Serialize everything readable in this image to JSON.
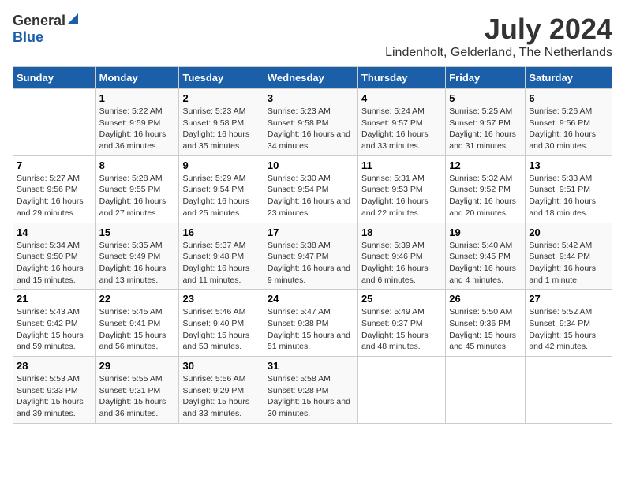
{
  "logo": {
    "general": "General",
    "blue": "Blue"
  },
  "title": {
    "month_year": "July 2024",
    "location": "Lindenholt, Gelderland, The Netherlands"
  },
  "days_of_week": [
    "Sunday",
    "Monday",
    "Tuesday",
    "Wednesday",
    "Thursday",
    "Friday",
    "Saturday"
  ],
  "weeks": [
    [
      {
        "num": "",
        "sunrise": "",
        "sunset": "",
        "daylight": ""
      },
      {
        "num": "1",
        "sunrise": "Sunrise: 5:22 AM",
        "sunset": "Sunset: 9:59 PM",
        "daylight": "Daylight: 16 hours and 36 minutes."
      },
      {
        "num": "2",
        "sunrise": "Sunrise: 5:23 AM",
        "sunset": "Sunset: 9:58 PM",
        "daylight": "Daylight: 16 hours and 35 minutes."
      },
      {
        "num": "3",
        "sunrise": "Sunrise: 5:23 AM",
        "sunset": "Sunset: 9:58 PM",
        "daylight": "Daylight: 16 hours and 34 minutes."
      },
      {
        "num": "4",
        "sunrise": "Sunrise: 5:24 AM",
        "sunset": "Sunset: 9:57 PM",
        "daylight": "Daylight: 16 hours and 33 minutes."
      },
      {
        "num": "5",
        "sunrise": "Sunrise: 5:25 AM",
        "sunset": "Sunset: 9:57 PM",
        "daylight": "Daylight: 16 hours and 31 minutes."
      },
      {
        "num": "6",
        "sunrise": "Sunrise: 5:26 AM",
        "sunset": "Sunset: 9:56 PM",
        "daylight": "Daylight: 16 hours and 30 minutes."
      }
    ],
    [
      {
        "num": "7",
        "sunrise": "Sunrise: 5:27 AM",
        "sunset": "Sunset: 9:56 PM",
        "daylight": "Daylight: 16 hours and 29 minutes."
      },
      {
        "num": "8",
        "sunrise": "Sunrise: 5:28 AM",
        "sunset": "Sunset: 9:55 PM",
        "daylight": "Daylight: 16 hours and 27 minutes."
      },
      {
        "num": "9",
        "sunrise": "Sunrise: 5:29 AM",
        "sunset": "Sunset: 9:54 PM",
        "daylight": "Daylight: 16 hours and 25 minutes."
      },
      {
        "num": "10",
        "sunrise": "Sunrise: 5:30 AM",
        "sunset": "Sunset: 9:54 PM",
        "daylight": "Daylight: 16 hours and 23 minutes."
      },
      {
        "num": "11",
        "sunrise": "Sunrise: 5:31 AM",
        "sunset": "Sunset: 9:53 PM",
        "daylight": "Daylight: 16 hours and 22 minutes."
      },
      {
        "num": "12",
        "sunrise": "Sunrise: 5:32 AM",
        "sunset": "Sunset: 9:52 PM",
        "daylight": "Daylight: 16 hours and 20 minutes."
      },
      {
        "num": "13",
        "sunrise": "Sunrise: 5:33 AM",
        "sunset": "Sunset: 9:51 PM",
        "daylight": "Daylight: 16 hours and 18 minutes."
      }
    ],
    [
      {
        "num": "14",
        "sunrise": "Sunrise: 5:34 AM",
        "sunset": "Sunset: 9:50 PM",
        "daylight": "Daylight: 16 hours and 15 minutes."
      },
      {
        "num": "15",
        "sunrise": "Sunrise: 5:35 AM",
        "sunset": "Sunset: 9:49 PM",
        "daylight": "Daylight: 16 hours and 13 minutes."
      },
      {
        "num": "16",
        "sunrise": "Sunrise: 5:37 AM",
        "sunset": "Sunset: 9:48 PM",
        "daylight": "Daylight: 16 hours and 11 minutes."
      },
      {
        "num": "17",
        "sunrise": "Sunrise: 5:38 AM",
        "sunset": "Sunset: 9:47 PM",
        "daylight": "Daylight: 16 hours and 9 minutes."
      },
      {
        "num": "18",
        "sunrise": "Sunrise: 5:39 AM",
        "sunset": "Sunset: 9:46 PM",
        "daylight": "Daylight: 16 hours and 6 minutes."
      },
      {
        "num": "19",
        "sunrise": "Sunrise: 5:40 AM",
        "sunset": "Sunset: 9:45 PM",
        "daylight": "Daylight: 16 hours and 4 minutes."
      },
      {
        "num": "20",
        "sunrise": "Sunrise: 5:42 AM",
        "sunset": "Sunset: 9:44 PM",
        "daylight": "Daylight: 16 hours and 1 minute."
      }
    ],
    [
      {
        "num": "21",
        "sunrise": "Sunrise: 5:43 AM",
        "sunset": "Sunset: 9:42 PM",
        "daylight": "Daylight: 15 hours and 59 minutes."
      },
      {
        "num": "22",
        "sunrise": "Sunrise: 5:45 AM",
        "sunset": "Sunset: 9:41 PM",
        "daylight": "Daylight: 15 hours and 56 minutes."
      },
      {
        "num": "23",
        "sunrise": "Sunrise: 5:46 AM",
        "sunset": "Sunset: 9:40 PM",
        "daylight": "Daylight: 15 hours and 53 minutes."
      },
      {
        "num": "24",
        "sunrise": "Sunrise: 5:47 AM",
        "sunset": "Sunset: 9:38 PM",
        "daylight": "Daylight: 15 hours and 51 minutes."
      },
      {
        "num": "25",
        "sunrise": "Sunrise: 5:49 AM",
        "sunset": "Sunset: 9:37 PM",
        "daylight": "Daylight: 15 hours and 48 minutes."
      },
      {
        "num": "26",
        "sunrise": "Sunrise: 5:50 AM",
        "sunset": "Sunset: 9:36 PM",
        "daylight": "Daylight: 15 hours and 45 minutes."
      },
      {
        "num": "27",
        "sunrise": "Sunrise: 5:52 AM",
        "sunset": "Sunset: 9:34 PM",
        "daylight": "Daylight: 15 hours and 42 minutes."
      }
    ],
    [
      {
        "num": "28",
        "sunrise": "Sunrise: 5:53 AM",
        "sunset": "Sunset: 9:33 PM",
        "daylight": "Daylight: 15 hours and 39 minutes."
      },
      {
        "num": "29",
        "sunrise": "Sunrise: 5:55 AM",
        "sunset": "Sunset: 9:31 PM",
        "daylight": "Daylight: 15 hours and 36 minutes."
      },
      {
        "num": "30",
        "sunrise": "Sunrise: 5:56 AM",
        "sunset": "Sunset: 9:29 PM",
        "daylight": "Daylight: 15 hours and 33 minutes."
      },
      {
        "num": "31",
        "sunrise": "Sunrise: 5:58 AM",
        "sunset": "Sunset: 9:28 PM",
        "daylight": "Daylight: 15 hours and 30 minutes."
      },
      {
        "num": "",
        "sunrise": "",
        "sunset": "",
        "daylight": ""
      },
      {
        "num": "",
        "sunrise": "",
        "sunset": "",
        "daylight": ""
      },
      {
        "num": "",
        "sunrise": "",
        "sunset": "",
        "daylight": ""
      }
    ]
  ]
}
